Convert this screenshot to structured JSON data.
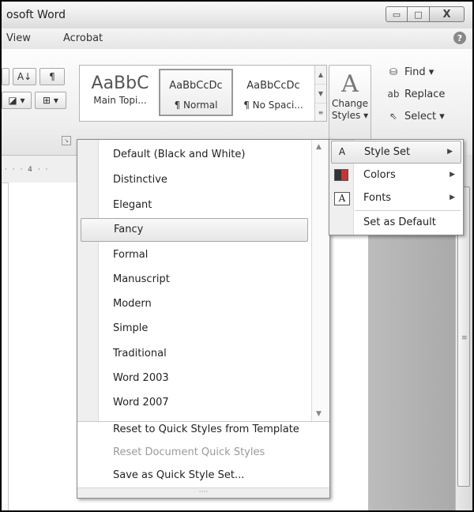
{
  "window": {
    "title": "osoft Word",
    "buttons": {
      "minimize": "▭",
      "maximize": "□",
      "close": "X"
    }
  },
  "menu_tabs": [
    "View",
    "Acrobat"
  ],
  "help_icon": "?",
  "ribbon": {
    "paragraph_buttons": [
      "A↓",
      "¶"
    ],
    "styles": [
      {
        "sample": "AaBbC",
        "name": "Main Topi..."
      },
      {
        "sample": "AaBbCcDc",
        "name": "¶ Normal"
      },
      {
        "sample": "AaBbCcDc",
        "name": "¶ No Spaci..."
      }
    ],
    "change_styles": {
      "line1": "Change",
      "line2": "Styles ▾"
    },
    "editing": {
      "find": "Find ▾",
      "replace": "Replace",
      "select": "Select ▾"
    }
  },
  "ruler": {
    "marks": "· · · 4 · ·"
  },
  "style_set_menu": {
    "items": [
      "Default (Black and White)",
      "Distinctive",
      "Elegant",
      "Fancy",
      "Formal",
      "Manuscript",
      "Modern",
      "Simple",
      "Traditional",
      "Word 2003",
      "Word 2007"
    ],
    "highlighted": "Fancy",
    "commands": {
      "reset_template": "Reset to Quick Styles from Template",
      "reset_document": "Reset Document Quick Styles",
      "save_set": "Save as Quick Style Set..."
    },
    "grip": "····"
  },
  "change_styles_menu": {
    "style_set": "Style Set",
    "colors": "Colors",
    "fonts": "Fonts",
    "set_default": "Set as Default"
  }
}
